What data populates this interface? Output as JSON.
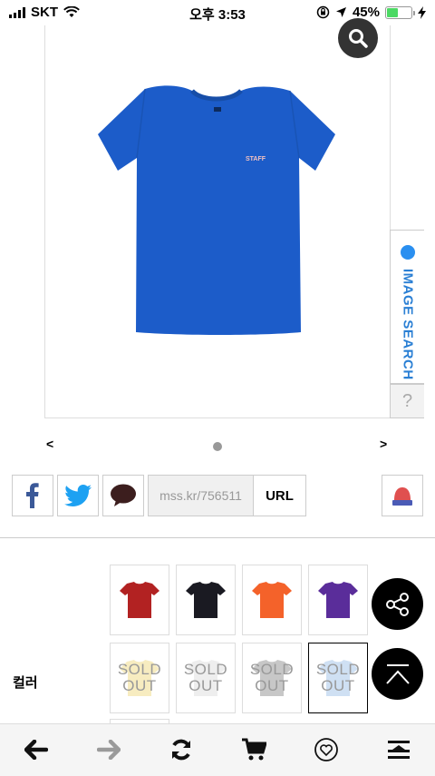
{
  "status_bar": {
    "carrier": "SKT",
    "time": "오후 3:53",
    "battery": "45%",
    "battery_level": 0.45
  },
  "product": {
    "image_alt": "blue t-shirt",
    "tee_text": "STAFF"
  },
  "overlay": {
    "image_search": "IMAGE SEARCH",
    "help": "?"
  },
  "carousel": {
    "prev": "<",
    "next": ">"
  },
  "share": {
    "url_value": "mss.kr/756511",
    "url_button": "URL"
  },
  "colors": {
    "label": "컬러",
    "swatches": [
      {
        "name": "red",
        "color": "#b22222"
      },
      {
        "name": "black",
        "color": "#1a1a22"
      },
      {
        "name": "orange",
        "color": "#f4622a"
      },
      {
        "name": "purple",
        "color": "#5a2d9a"
      }
    ],
    "soldout": [
      {
        "line1": "SOLD",
        "line2": "OUT",
        "color": "#f7ecc0"
      },
      {
        "line1": "SOLD",
        "line2": "OUT",
        "color": "#eeeeee"
      },
      {
        "line1": "SOLD",
        "line2": "OUT",
        "color": "#c7c7c7"
      },
      {
        "line1": "SOLD",
        "line2": "OUT",
        "color": "#cfe0f3"
      }
    ]
  },
  "toolbar": {
    "icons": [
      "back-arrow-icon",
      "forward-arrow-icon",
      "refresh-icon",
      "cart-icon",
      "heart-icon",
      "menu-icon"
    ]
  },
  "accent": {
    "shirt_blue": "#1c5cc9",
    "link_blue": "#2a7fd4"
  }
}
